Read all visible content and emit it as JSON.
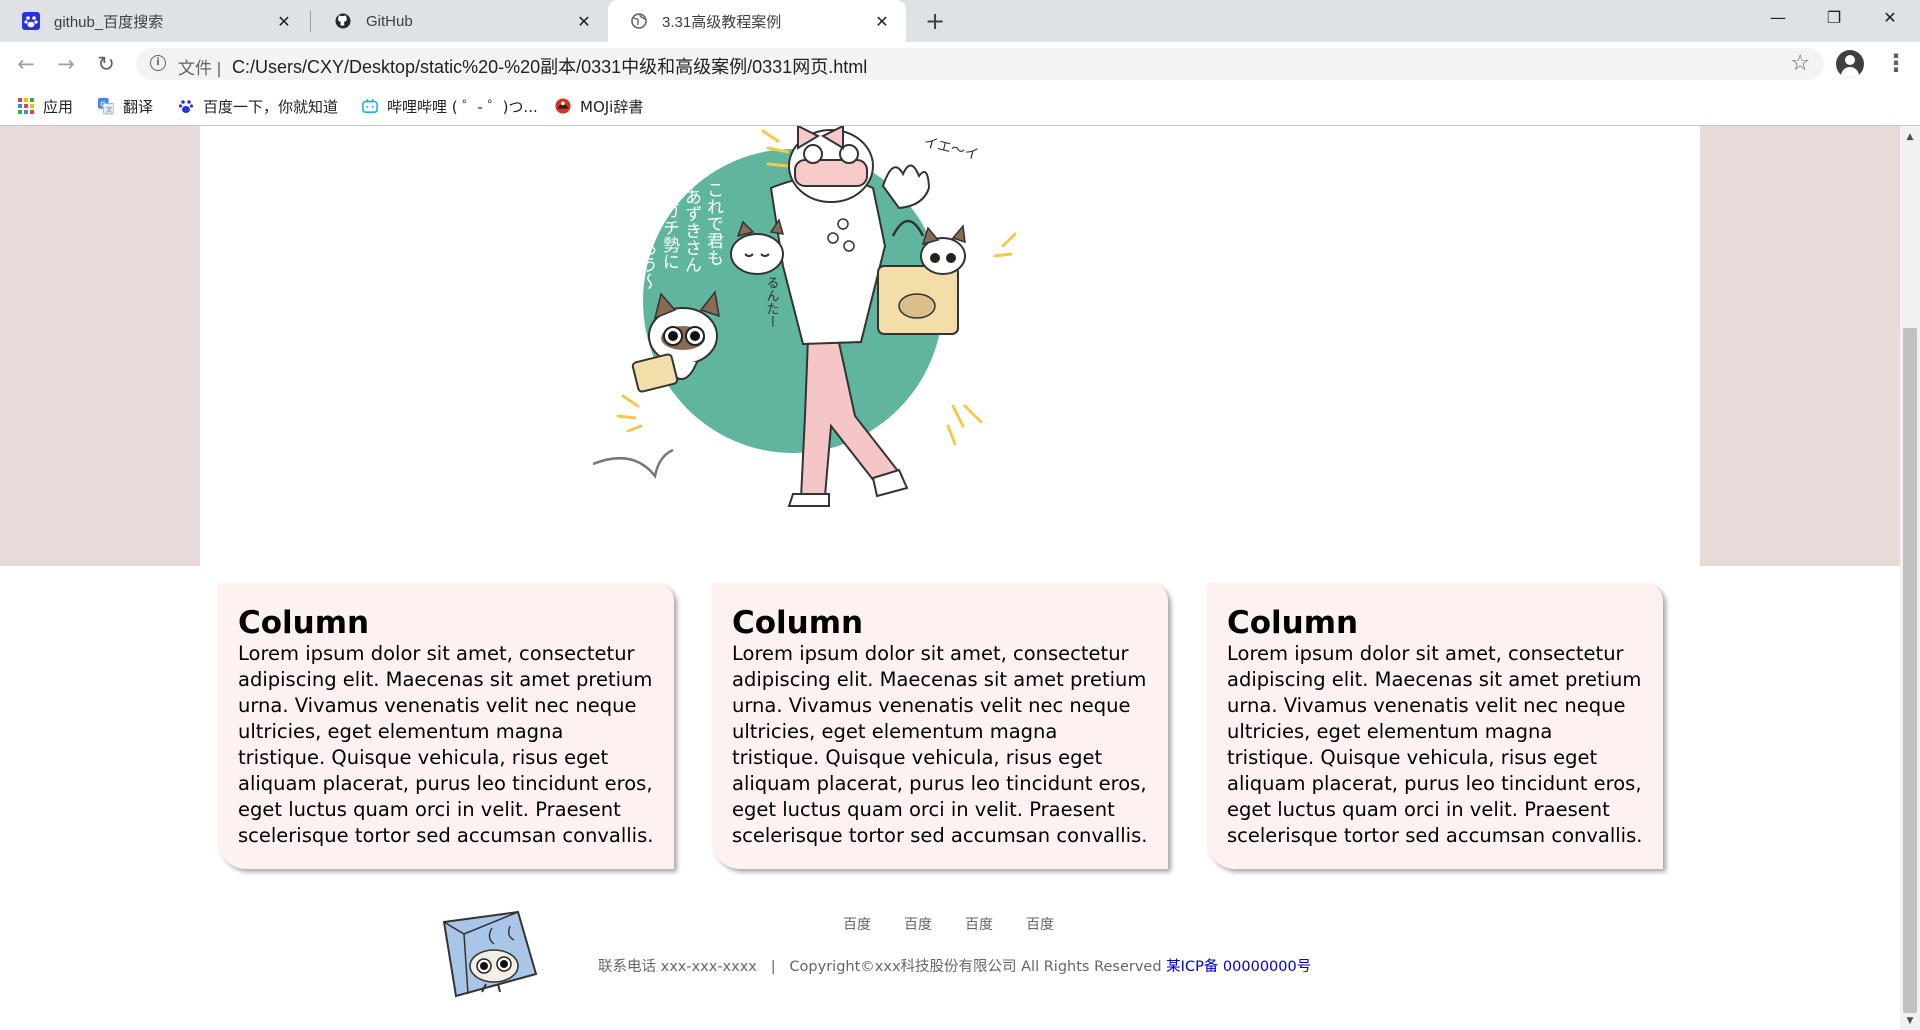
{
  "browser": {
    "tabs": [
      {
        "title": "github_百度搜索",
        "icon": "baidu-paw-icon",
        "active": false
      },
      {
        "title": "GitHub",
        "icon": "github-icon",
        "active": false
      },
      {
        "title": "3.31高级教程案例",
        "icon": "globe-icon",
        "active": true
      }
    ],
    "address": {
      "scheme_label": "文件",
      "separator": "|",
      "url": "C:/Users/CXY/Desktop/static%20-%20副本/0331中级和高级案例/0331网页.html"
    },
    "bookmarks": [
      {
        "label": "应用",
        "icon": "apps-grid-icon",
        "color": "#ea4335"
      },
      {
        "label": "翻译",
        "icon": "translate-icon",
        "color": "#4285f4"
      },
      {
        "label": "百度一下，你就知道",
        "icon": "baidu-paw-icon",
        "color": "#2932e1"
      },
      {
        "label": "哔哩哔哩 ( ゜- ゜)つ...",
        "icon": "bilibili-tv-icon",
        "color": "#23ade5"
      },
      {
        "label": "MOJi辞書",
        "icon": "moji-icon",
        "color": "#d93025"
      }
    ]
  },
  "page": {
    "hero_colors": {
      "band": "#e7dad9",
      "inner": "#ffffff",
      "circle": "#5fb59e"
    },
    "hero_illustration": {
      "vertical_text_lines": [
        "これで君も",
        "あずきさん",
        "ガチ勢に",
        "なろう〜"
      ],
      "shout_text": "イエ〜イ",
      "side_text": "るんたー"
    },
    "columns": [
      {
        "heading": "Column",
        "body": "Lorem ipsum dolor sit amet, consectetur adipiscing elit. Maecenas sit amet pretium urna. Vivamus venenatis velit nec neque ultricies, eget elementum magna tristique. Quisque vehicula, risus eget aliquam placerat, purus leo tincidunt eros, eget luctus quam orci in velit. Praesent scelerisque tortor sed accumsan convallis."
      },
      {
        "heading": "Column",
        "body": "Lorem ipsum dolor sit amet, consectetur adipiscing elit. Maecenas sit amet pretium urna. Vivamus venenatis velit nec neque ultricies, eget elementum magna tristique. Quisque vehicula, risus eget aliquam placerat, purus leo tincidunt eros, eget luctus quam orci in velit. Praesent scelerisque tortor sed accumsan convallis."
      },
      {
        "heading": "Column",
        "body": "Lorem ipsum dolor sit amet, consectetur adipiscing elit. Maecenas sit amet pretium urna. Vivamus venenatis velit nec neque ultricies, eget elementum magna tristique. Quisque vehicula, risus eget aliquam placerat, purus leo tincidunt eros, eget luctus quam orci in velit. Praesent scelerisque tortor sed accumsan convallis."
      }
    ],
    "footer": {
      "links": [
        "百度",
        "百度",
        "百度",
        "百度"
      ],
      "phone": "联系电话 xxx-xxx-xxxx",
      "divider": "|",
      "copyright": "Copyright©xxx科技股份有限公司 All Rights Reserved",
      "icp": "某ICP备 00000000号"
    }
  }
}
